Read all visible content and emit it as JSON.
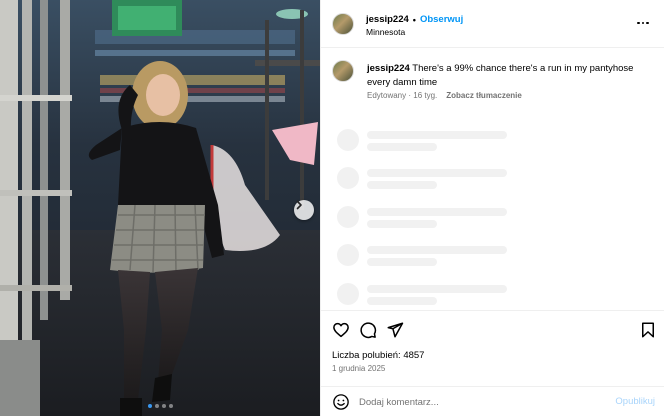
{
  "post": {
    "username": "jessip224",
    "separator": "•",
    "follow_label": "Obserwuj",
    "location": "Minnesota",
    "caption_username": "jessip224",
    "caption_text": "There's a 99% chance there's a run in my pantyhose every damn time",
    "edited_label": "Edytowany · 16 tyg.",
    "translate_label": "Zobacz tłumaczenie",
    "likes_label": "Liczba polubień:",
    "likes_count": "4857",
    "date": "1 grudnia 2025"
  },
  "carousel": {
    "total_slides": 4,
    "active_slide": 1
  },
  "comment": {
    "placeholder": "Dodaj komentarz...",
    "publish_label": "Opublikuj"
  },
  "icons": {
    "more": "more-horizontal-icon",
    "like": "heart-icon",
    "comment": "comment-icon",
    "share": "send-icon",
    "save": "bookmark-icon",
    "emoji": "emoji-icon",
    "next": "chevron-right-icon"
  },
  "colors": {
    "link": "#0095f6",
    "publish_disabled": "#a8d4fb",
    "meta": "#737373",
    "carousel_active": "#3897f0"
  }
}
